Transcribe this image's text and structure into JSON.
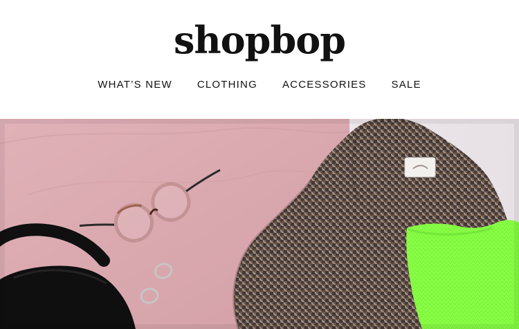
{
  "brand": {
    "logo_text": "shopbop"
  },
  "nav": {
    "items": [
      {
        "label": "WHAT’S NEW"
      },
      {
        "label": "CLOTHING"
      },
      {
        "label": "ACCESSORIES"
      },
      {
        "label": "SALE"
      }
    ]
  },
  "hero": {
    "colors": {
      "pink_backdrop": "#d8a7ad",
      "light_backdrop": "#e9e3e6",
      "neon_green": "#8aff45",
      "black_bag": "#0f0f10"
    },
    "items": [
      "tortoiseshell-glasses-icon",
      "hoop-earrings-icon",
      "black-handbag-icon",
      "houndstooth-blazer-icon",
      "neon-green-knit-top-icon"
    ]
  }
}
